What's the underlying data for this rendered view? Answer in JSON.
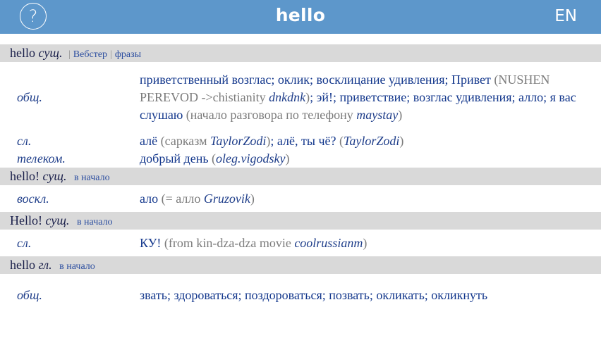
{
  "header": {
    "help_icon_glyph": "?",
    "title": "hello",
    "lang": "EN",
    "bar_color": "#5d97cb"
  },
  "sections": [
    {
      "word": "hello",
      "pos": "сущ.",
      "link1": "Вебстер",
      "link2": "фразы",
      "rows": [
        {
          "subject": "общ.",
          "parts": [
            {
              "t": "приветственный возглас; оклик; восклицание удивления; Привет "
            },
            {
              "t": "(NUSHEN PEREVOD ->chistianity ",
              "c": "note"
            },
            {
              "t": "dnkdnk",
              "c": "auth"
            },
            {
              "t": ")",
              "c": "note"
            },
            {
              "t": "; эй!; приветствие; возглас удивления; алло; я вас слушаю "
            },
            {
              "t": "(начало разговора по телефону ",
              "c": "note"
            },
            {
              "t": "maystay",
              "c": "auth"
            },
            {
              "t": ")",
              "c": "note"
            }
          ]
        },
        {
          "subject": "сл.",
          "parts": [
            {
              "t": "алё "
            },
            {
              "t": "(сарказм ",
              "c": "note"
            },
            {
              "t": "TaylorZodi",
              "c": "auth"
            },
            {
              "t": ")",
              "c": "note"
            },
            {
              "t": "; алё, ты чё? "
            },
            {
              "t": "(",
              "c": "note"
            },
            {
              "t": "TaylorZodi",
              "c": "auth"
            },
            {
              "t": ")",
              "c": "note"
            }
          ]
        },
        {
          "subject": "телеком.",
          "parts": [
            {
              "t": "добрый день "
            },
            {
              "t": "(",
              "c": "note"
            },
            {
              "t": "oleg.vigodsky",
              "c": "auth"
            },
            {
              "t": ")",
              "c": "note"
            }
          ]
        }
      ]
    },
    {
      "word": "hello!",
      "pos": "сущ.",
      "small": "в начало",
      "rows": [
        {
          "subject": "воскл.",
          "parts": [
            {
              "t": "ало "
            },
            {
              "t": "(= алло ",
              "c": "note"
            },
            {
              "t": "Gruzovik",
              "c": "auth"
            },
            {
              "t": ")",
              "c": "note"
            }
          ]
        }
      ]
    },
    {
      "word": "Hello!",
      "pos": "сущ.",
      "small": "в начало",
      "rows": [
        {
          "subject": "сл.",
          "parts": [
            {
              "t": "КУ! "
            },
            {
              "t": "(from kin-dza-dza movie ",
              "c": "note"
            },
            {
              "t": "coolrussianm",
              "c": "auth"
            },
            {
              "t": ")",
              "c": "note"
            }
          ]
        }
      ]
    },
    {
      "word": "hello",
      "pos": "гл.",
      "small": "в начало",
      "rows": [
        {
          "subject": "общ.",
          "parts": [
            {
              "t": "звать; здороваться; поздороваться; позвать; окликать; окликнуть"
            }
          ]
        }
      ]
    }
  ]
}
